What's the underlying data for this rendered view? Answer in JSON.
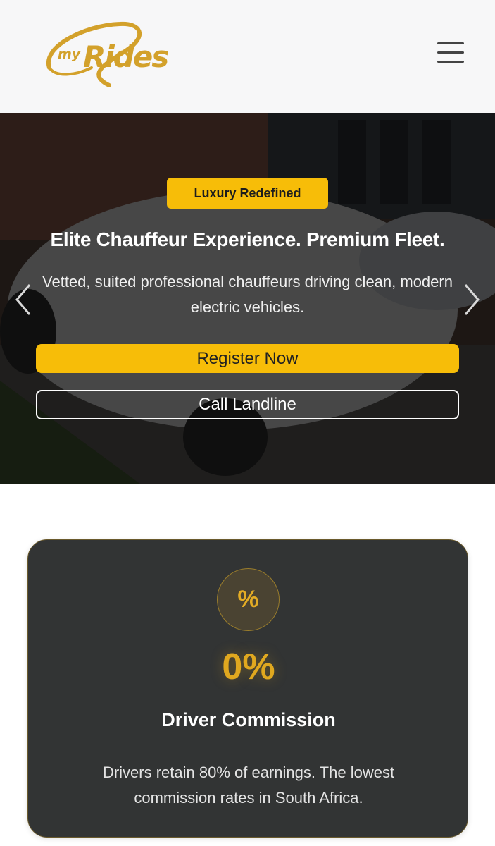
{
  "header": {
    "logo_small": "my",
    "logo_main": "Rides",
    "menu_icon": "hamburger-menu-icon"
  },
  "hero": {
    "badge": "Luxury Redefined",
    "title": "Elite Chauffeur Experience. Premium Fleet.",
    "subtitle": "Vetted, suited professional chauffeurs driving clean, modern electric vehicles.",
    "primary_button": "Register Now",
    "secondary_button": "Call Landline",
    "prev_icon": "chevron-left-icon",
    "next_icon": "chevron-right-icon"
  },
  "stat_card": {
    "icon": "percent-icon",
    "icon_glyph": "%",
    "value": "0%",
    "title": "Driver Commission",
    "description": "Drivers retain 80% of earnings. The lowest commission rates in South Africa."
  },
  "colors": {
    "accent": "#f7bd08",
    "gold_text": "#e0a81f",
    "card_bg": "#323434",
    "header_bg": "#f7f7f8"
  }
}
